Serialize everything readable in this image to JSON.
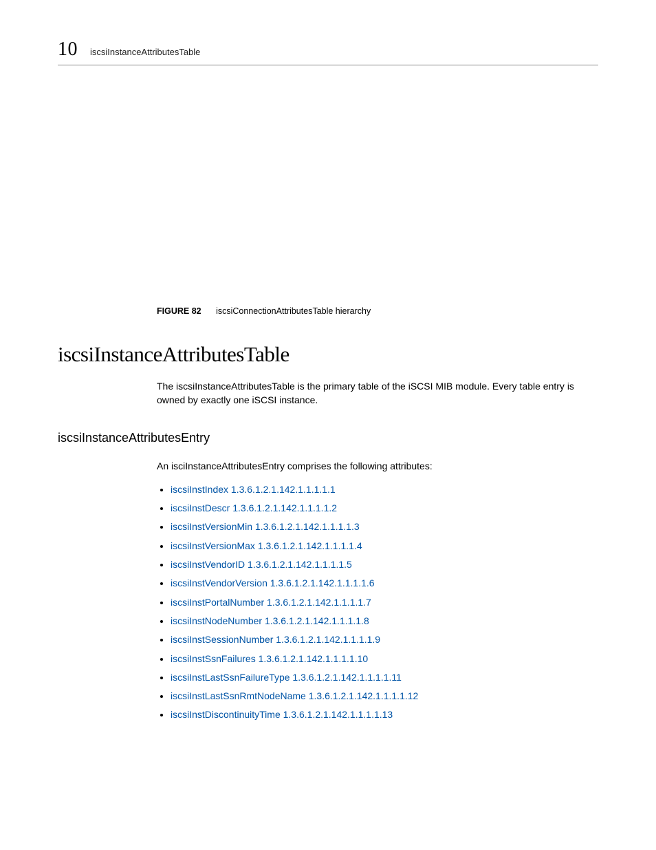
{
  "header": {
    "page_number": "10",
    "title": "iscsiInstanceAttributesTable"
  },
  "figure": {
    "label": "FIGURE 82",
    "caption": "iscsiConnectionAttributesTable hierarchy"
  },
  "section": {
    "heading": "iscsiInstanceAttributesTable",
    "intro": "The iscsiInstanceAttributesTable is the primary table of the iSCSI MIB module. Every table entry is owned by exactly one iSCSI instance."
  },
  "subsection": {
    "heading": "iscsiInstanceAttributesEntry",
    "intro": "An isciInstanceAttributesEntry comprises the following attributes:",
    "items": [
      "iscsiInstIndex 1.3.6.1.2.1.142.1.1.1.1.1",
      "iscsiInstDescr 1.3.6.1.2.1.142.1.1.1.1.2",
      "iscsiInstVersionMin 1.3.6.1.2.1.142.1.1.1.1.3",
      "iscsiInstVersionMax 1.3.6.1.2.1.142.1.1.1.1.4",
      "iscsiInstVendorID 1.3.6.1.2.1.142.1.1.1.1.5",
      "iscsiInstVendorVersion 1.3.6.1.2.1.142.1.1.1.1.6",
      "iscsiInstPortalNumber 1.3.6.1.2.1.142.1.1.1.1.7",
      "iscsiInstNodeNumber 1.3.6.1.2.1.142.1.1.1.1.8",
      "iscsiInstSessionNumber 1.3.6.1.2.1.142.1.1.1.1.9",
      "iscsiInstSsnFailures 1.3.6.1.2.1.142.1.1.1.1.10",
      "iscsiInstLastSsnFailureType 1.3.6.1.2.1.142.1.1.1.1.11",
      "iscsiInstLastSsnRmtNodeName 1.3.6.1.2.1.142.1.1.1.1.12",
      "iscsiInstDiscontinuityTime 1.3.6.1.2.1.142.1.1.1.1.13"
    ]
  }
}
